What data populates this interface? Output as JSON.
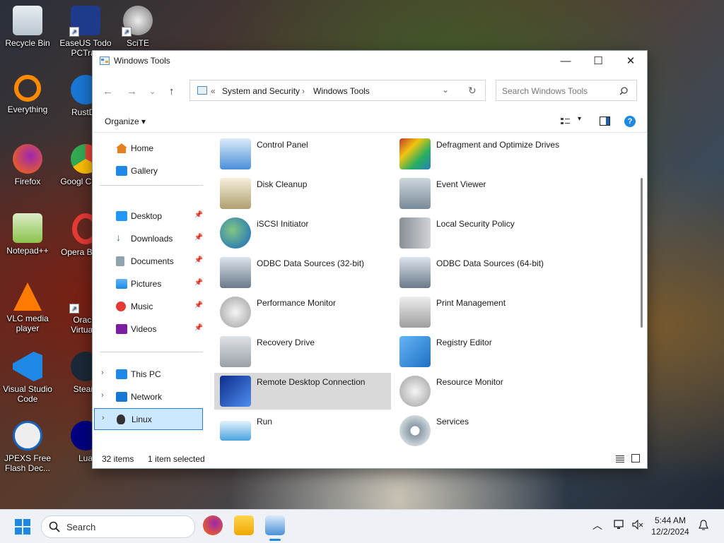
{
  "desktop": {
    "icons": [
      {
        "label": "Recycle Bin",
        "color": "#cfd8dc"
      },
      {
        "label": "EaseUS Todo PCTran",
        "color": "#1e3a8a"
      },
      {
        "label": "SciTE",
        "color": "#9e9e9e"
      },
      {
        "label": "Everything",
        "color": "#ff8a00"
      },
      {
        "label": "RustDe",
        "color": "#1976d2"
      },
      {
        "label": "Firefox",
        "color": "#ff6d00"
      },
      {
        "label": "Googl Chrom",
        "color": "#4caf50"
      },
      {
        "label": "Notepad++",
        "color": "#8bc34a"
      },
      {
        "label": "Opera Brows",
        "color": "#e53935"
      },
      {
        "label": "VLC media player",
        "color": "#ff7a00"
      },
      {
        "label": "Oracle VirtualB",
        "color": "#1565c0"
      },
      {
        "label": "Visual Studio Code",
        "color": "#1e88e5"
      },
      {
        "label": "Steam",
        "color": "#1b2838"
      },
      {
        "label": "JPEXS Free Flash Dec...",
        "color": "#e0e0e0"
      },
      {
        "label": "Lua",
        "color": "#000080"
      }
    ]
  },
  "window": {
    "title": "Windows Tools",
    "controls": {
      "minimize": "—",
      "maximize": "☐",
      "close": "✕"
    },
    "address": {
      "overflow": "«",
      "crumbs": [
        "System and Security",
        "Windows Tools"
      ],
      "separator": "›"
    },
    "search": {
      "placeholder": "Search Windows Tools"
    },
    "command_bar": {
      "organize": "Organize"
    },
    "nav": {
      "top": [
        {
          "label": "Home",
          "icon": "home-icon",
          "color": "#e67e22"
        },
        {
          "label": "Gallery",
          "icon": "gallery-icon",
          "color": "#1e88e5"
        }
      ],
      "quick_access": [
        {
          "label": "Desktop",
          "icon": "desktop-folder-icon",
          "color": "#2196f3"
        },
        {
          "label": "Downloads",
          "icon": "downloads-icon",
          "color": "#2e7d32"
        },
        {
          "label": "Documents",
          "icon": "documents-icon",
          "color": "#607d8b"
        },
        {
          "label": "Pictures",
          "icon": "pictures-icon",
          "color": "#1e88e5"
        },
        {
          "label": "Music",
          "icon": "music-icon",
          "color": "#e53935"
        },
        {
          "label": "Videos",
          "icon": "videos-icon",
          "color": "#7b1fa2"
        }
      ],
      "locations": [
        {
          "label": "This PC",
          "icon": "this-pc-icon",
          "color": "#1e88e5"
        },
        {
          "label": "Network",
          "icon": "network-icon",
          "color": "#1976d2"
        },
        {
          "label": "Linux",
          "icon": "linux-icon",
          "color": "#333333"
        }
      ]
    },
    "tools": [
      {
        "label": "Control Panel",
        "color": "#4a90d9"
      },
      {
        "label": "Defragment and Optimize Drives",
        "color": "#c0392b"
      },
      {
        "label": "Disk Cleanup",
        "color": "#b0a070"
      },
      {
        "label": "Event Viewer",
        "color": "#7a8a9a"
      },
      {
        "label": "iSCSI Initiator",
        "color": "#2e7d32"
      },
      {
        "label": "Local Security Policy",
        "color": "#8a8f96"
      },
      {
        "label": "ODBC Data Sources (32-bit)",
        "color": "#6a7a8a"
      },
      {
        "label": "ODBC Data Sources (64-bit)",
        "color": "#6a7a8a"
      },
      {
        "label": "Performance Monitor",
        "color": "#b0b0b0"
      },
      {
        "label": "Print Management",
        "color": "#9e9e9e"
      },
      {
        "label": "Recovery Drive",
        "color": "#9aa0a6"
      },
      {
        "label": "Registry Editor",
        "color": "#1f6fc5"
      },
      {
        "label": "Remote Desktop Connection",
        "color": "#1a56c4"
      },
      {
        "label": "Resource Monitor",
        "color": "#b0b0b0"
      },
      {
        "label": "Run",
        "color": "#4aa3df"
      },
      {
        "label": "Services",
        "color": "#8a9aa8"
      }
    ],
    "status": {
      "count": "32 items",
      "selection": "1 item selected"
    }
  },
  "taskbar": {
    "search_label": "Search",
    "clock_time": "5:44 AM",
    "clock_date": "12/2/2024"
  }
}
